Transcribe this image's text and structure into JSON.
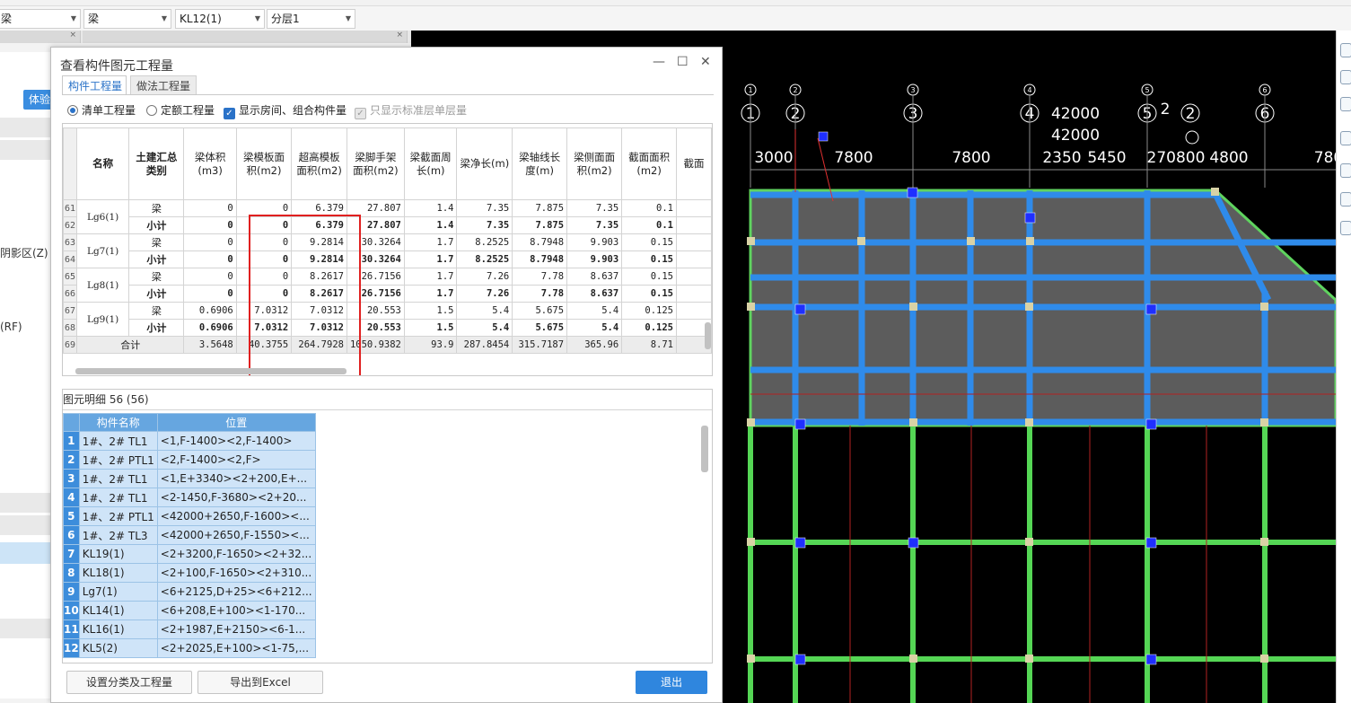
{
  "toolbar": {
    "combos": [
      "梁",
      "梁",
      "KL12(1)",
      "分层1"
    ]
  },
  "left_panel": {
    "button": "体验",
    "texts": [
      "阴影区(Z)",
      "(RF)"
    ]
  },
  "dialog": {
    "title": "查看构件图元工程量",
    "tabs": [
      "构件工程量",
      "做法工程量"
    ],
    "options": {
      "radio1": "清单工程量",
      "radio2": "定额工程量",
      "check1": "显示房间、组合构件量",
      "check2": "只显示标准层单层量"
    },
    "table": {
      "headers": [
        "名称",
        "土建汇总类别",
        "梁体积(m3)",
        "梁模板面积(m2)",
        "超高模板面积(m2)",
        "梁脚手架面积(m2)",
        "梁截面周长(m)",
        "梁净长(m)",
        "梁轴线长度(m)",
        "梁侧面面积(m2)",
        "截面面积(m2)",
        "截面"
      ],
      "rows": [
        {
          "rn": "61",
          "name": "Lg6(1)",
          "cat": "梁",
          "vals": [
            "0",
            "0",
            "6.379",
            "27.807",
            "1.4",
            "7.35",
            "7.875",
            "7.35",
            "0.1"
          ]
        },
        {
          "rn": "62",
          "name": "",
          "cat": "小计",
          "vals": [
            "0",
            "0",
            "6.379",
            "27.807",
            "1.4",
            "7.35",
            "7.875",
            "7.35",
            "0.1"
          ]
        },
        {
          "rn": "63",
          "name": "Lg7(1)",
          "cat": "梁",
          "vals": [
            "0",
            "0",
            "9.2814",
            "30.3264",
            "1.7",
            "8.2525",
            "8.7948",
            "9.903",
            "0.15"
          ]
        },
        {
          "rn": "64",
          "name": "",
          "cat": "小计",
          "vals": [
            "0",
            "0",
            "9.2814",
            "30.3264",
            "1.7",
            "8.2525",
            "8.7948",
            "9.903",
            "0.15"
          ]
        },
        {
          "rn": "65",
          "name": "Lg8(1)",
          "cat": "梁",
          "vals": [
            "0",
            "0",
            "8.2617",
            "26.7156",
            "1.7",
            "7.26",
            "7.78",
            "8.637",
            "0.15"
          ]
        },
        {
          "rn": "66",
          "name": "",
          "cat": "小计",
          "vals": [
            "0",
            "0",
            "8.2617",
            "26.7156",
            "1.7",
            "7.26",
            "7.78",
            "8.637",
            "0.15"
          ]
        },
        {
          "rn": "67",
          "name": "Lg9(1)",
          "cat": "梁",
          "vals": [
            "0.6906",
            "7.0312",
            "7.0312",
            "20.553",
            "1.5",
            "5.4",
            "5.675",
            "5.4",
            "0.125"
          ]
        },
        {
          "rn": "68",
          "name": "",
          "cat": "小计",
          "vals": [
            "0.6906",
            "7.0312",
            "7.0312",
            "20.553",
            "1.5",
            "5.4",
            "5.675",
            "5.4",
            "0.125"
          ]
        }
      ],
      "total": {
        "rn": "69",
        "label": "合计",
        "vals": [
          "3.5648",
          "40.3755",
          "264.7928",
          "1050.9382",
          "93.9",
          "287.8454",
          "315.7187",
          "365.96",
          "8.71"
        ]
      }
    },
    "detail": {
      "title": "图元明细  56 (56)",
      "headers": [
        "构件名称",
        "位置"
      ],
      "rows": [
        {
          "i": "1",
          "name": "1#、2# TL1",
          "pos": "<1,F-1400><2,F-1400>"
        },
        {
          "i": "2",
          "name": "1#、2# PTL1",
          "pos": "<2,F-1400><2,F>"
        },
        {
          "i": "3",
          "name": "1#、2# TL1",
          "pos": "<1,E+3340><2+200,E+..."
        },
        {
          "i": "4",
          "name": "1#、2# TL1",
          "pos": "<2-1450,F-3680><2+20..."
        },
        {
          "i": "5",
          "name": "1#、2# PTL1",
          "pos": "<42000+2650,F-1600><..."
        },
        {
          "i": "6",
          "name": "1#、2# TL3",
          "pos": "<42000+2650,F-1550><..."
        },
        {
          "i": "7",
          "name": "KL19(1)",
          "pos": "<2+3200,F-1650><2+32..."
        },
        {
          "i": "8",
          "name": "KL18(1)",
          "pos": "<2+100,F-1650><2+310..."
        },
        {
          "i": "9",
          "name": "Lg7(1)",
          "pos": "<6+2125,D+25><6+212..."
        },
        {
          "i": "10",
          "name": "KL14(1)",
          "pos": "<6+208,E+100><1-170..."
        },
        {
          "i": "11",
          "name": "KL16(1)",
          "pos": "<2+1987,E+2150><6-1..."
        },
        {
          "i": "12",
          "name": "KL5(2)",
          "pos": "<2+2025,E+100><1-75,..."
        }
      ]
    },
    "buttons": {
      "settings": "设置分类及工程量",
      "export": "导出到Excel",
      "exit": "退出"
    }
  },
  "cad": {
    "axis_labels": [
      "1",
      "2",
      "3",
      "4",
      "5",
      "6",
      "2"
    ],
    "dims_top": [
      "42000",
      "42000"
    ],
    "dims": [
      "3000",
      "7800",
      "7800",
      "2350",
      "5450",
      "270800",
      "4800",
      "780"
    ]
  }
}
